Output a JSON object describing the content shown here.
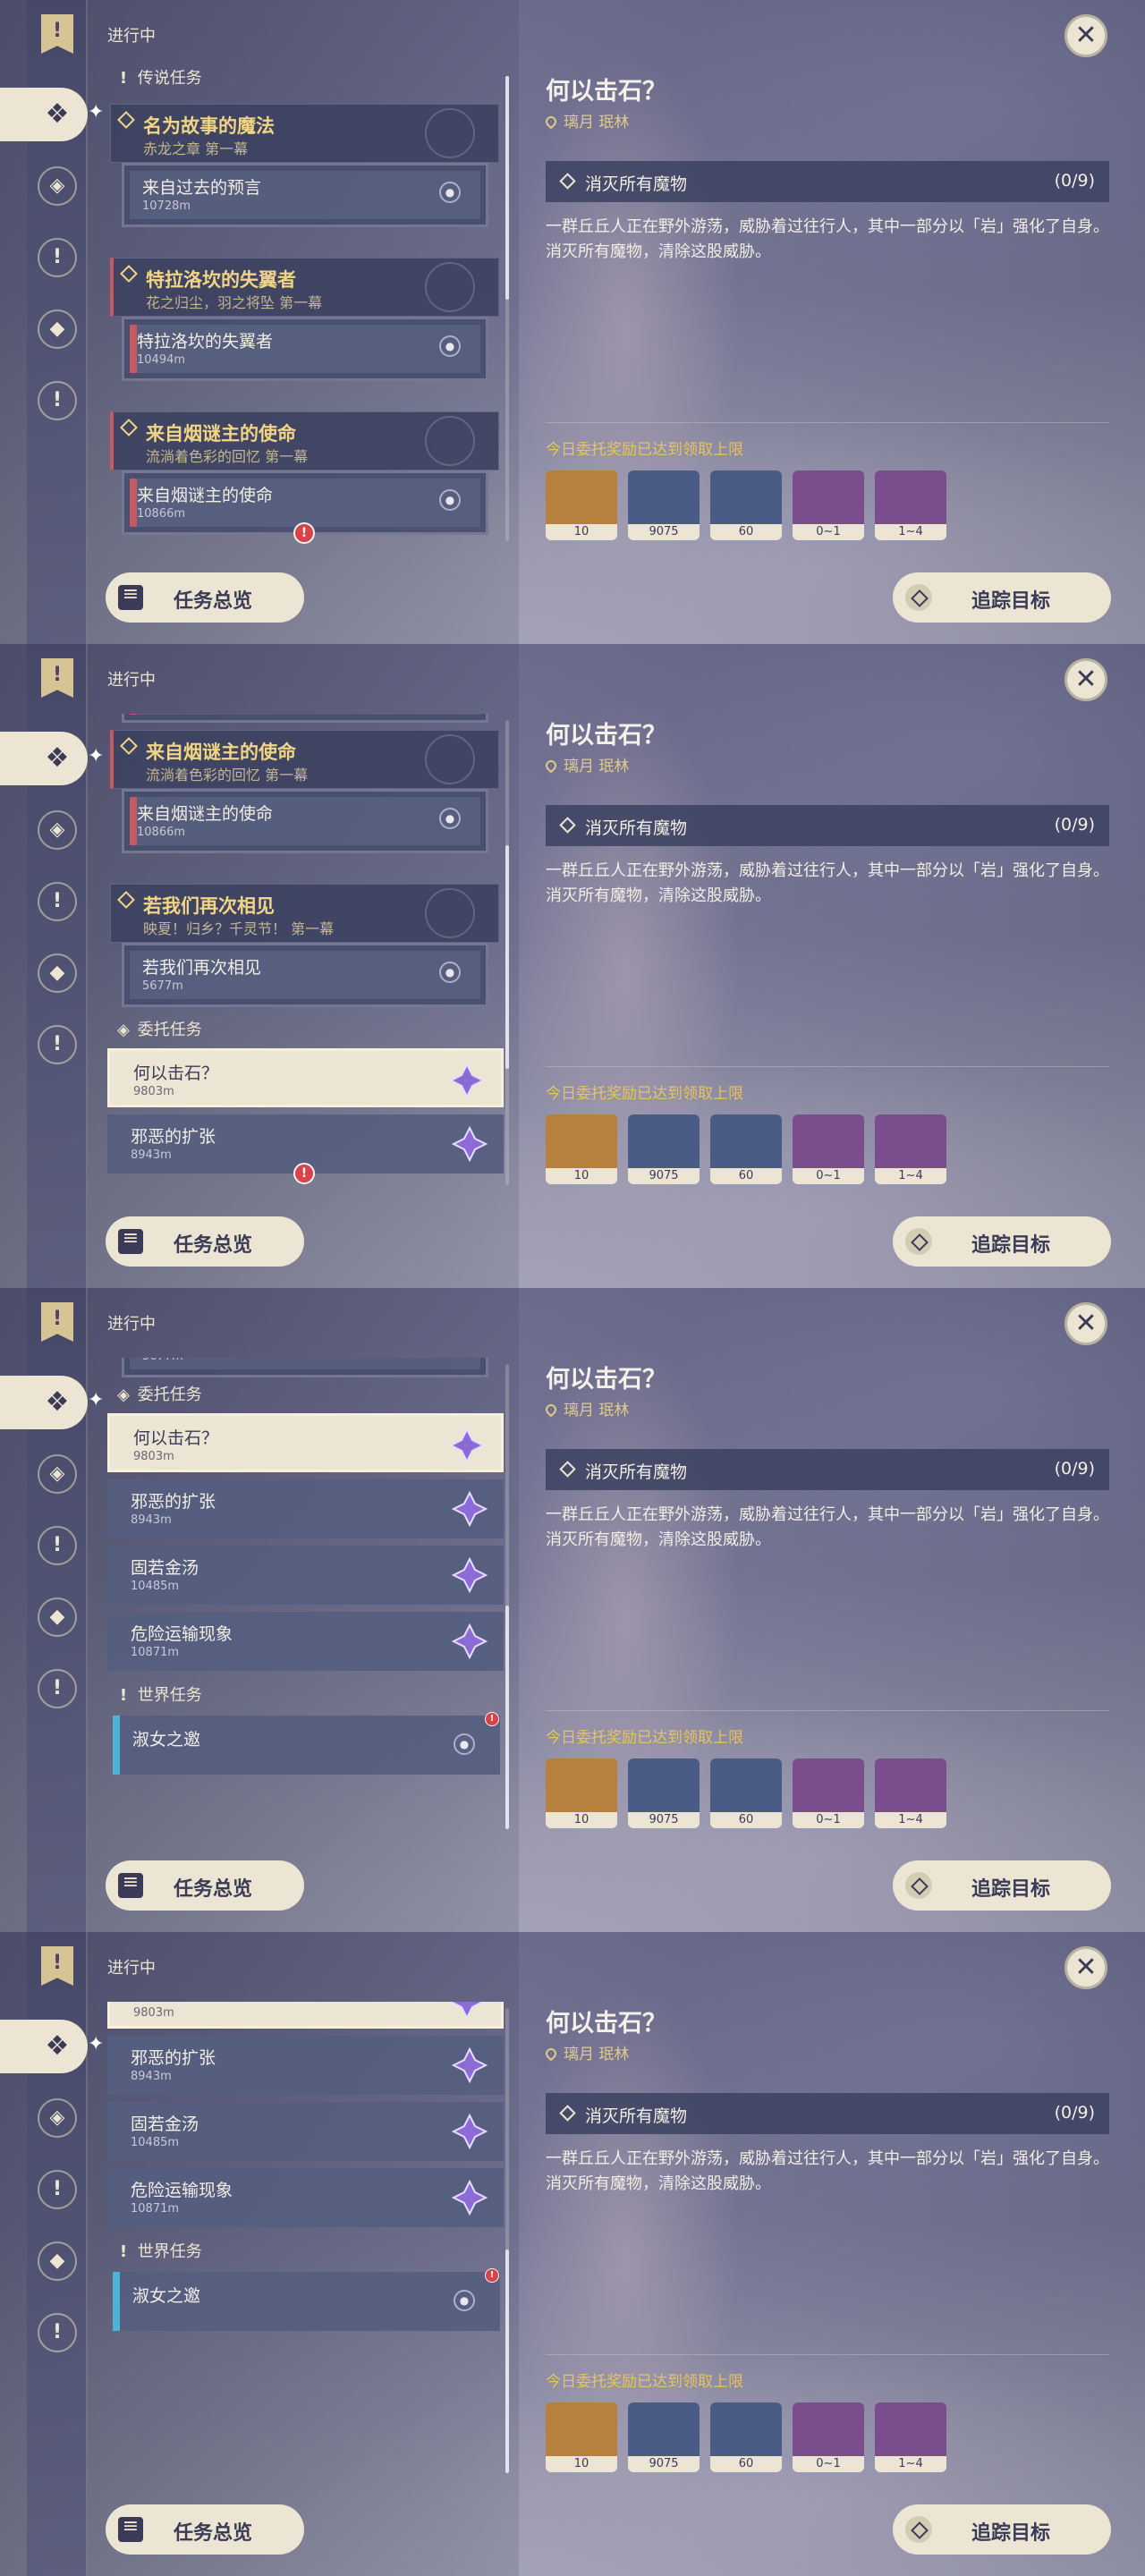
{
  "header": {
    "status": "进行中",
    "close_glyph": "✕"
  },
  "sections": {
    "legend": "传说任务",
    "commission": "委托任务",
    "world": "世界任务"
  },
  "legend_quests": [
    {
      "title": "名为故事的魔法",
      "sub": "赤龙之章 第一幕",
      "card": "来自过去的预言",
      "dist": "10728m",
      "red": false
    },
    {
      "title": "特拉洛坎的失翼者",
      "sub": "花之归尘，羽之将坠 第一幕",
      "card": "特拉洛坎的失翼者",
      "dist": "10494m",
      "red": true
    },
    {
      "title": "来自烟谜主的使命",
      "sub": "流淌着色彩的回忆 第一幕",
      "card": "来自烟谜主的使命",
      "dist": "10866m",
      "red": true
    },
    {
      "title": "若我们再次相见",
      "sub": "映夏！归乡？千灵节！ 第一幕",
      "card": "若我们再次相见",
      "dist": "5677m",
      "red": false
    }
  ],
  "commissions": [
    {
      "title": "何以击石？",
      "dist": "9803m"
    },
    {
      "title": "邪恶的扩张",
      "dist": "8943m"
    },
    {
      "title": "固若金汤",
      "dist": "10485m"
    },
    {
      "title": "危险运输现象",
      "dist": "10871m"
    }
  ],
  "world_quests": [
    {
      "title": "淑女之邀"
    }
  ],
  "buttons": {
    "overview": "任务总览",
    "track": "追踪目标"
  },
  "detail": {
    "title": "何以击石？",
    "location": "璃月 珉林",
    "objective": "消灭所有魔物",
    "progress": "(0/9)",
    "description": "一群丘丘人正在野外游荡，威胁着过往行人，其中一部分以「岩」强化了自身。消灭所有魔物，清除这股威胁。",
    "reward_note": "今日委托奖励已达到领取上限",
    "rewards": [
      {
        "icon": "adventure-exp-icon",
        "count": "10"
      },
      {
        "icon": "mora-icon",
        "count": "9075"
      },
      {
        "icon": "friendship-exp-icon",
        "count": "60"
      },
      {
        "icon": "primogem-crystal-icon",
        "count": "0~1"
      },
      {
        "icon": "crystal-chunk-icon",
        "count": "1~4"
      }
    ]
  },
  "colors": {
    "accent_gold": "#f1d585",
    "cream": "#ece5d3",
    "alert_red": "#d8424a",
    "world_blue": "#4fb2d6"
  }
}
